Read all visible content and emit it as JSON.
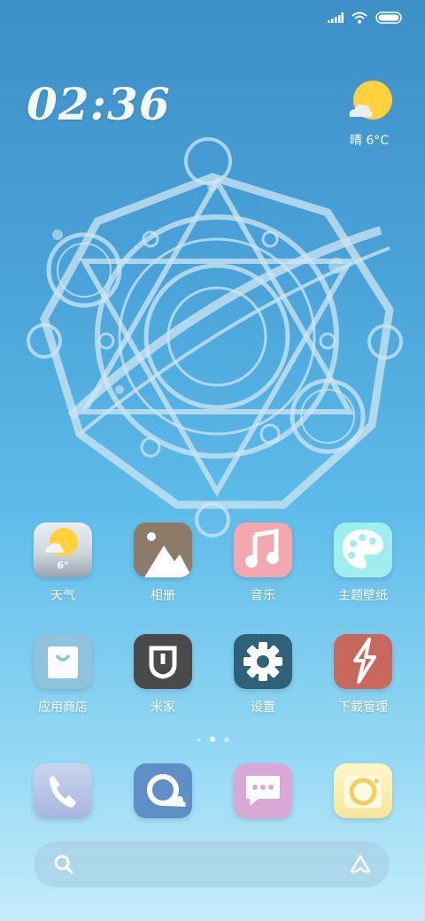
{
  "status_bar": {
    "icons": [
      "signal-icon",
      "wifi-icon",
      "battery-icon"
    ]
  },
  "clock": {
    "time": "02:36"
  },
  "weather": {
    "condition_temp": "晴  6°C",
    "icon": "sun-cloud-icon"
  },
  "apps": [
    {
      "label": "天气",
      "icon": "weather-icon",
      "badge": "6°"
    },
    {
      "label": "相册",
      "icon": "gallery-icon"
    },
    {
      "label": "音乐",
      "icon": "music-icon"
    },
    {
      "label": "主题壁纸",
      "icon": "palette-icon"
    },
    {
      "label": "应用商店",
      "icon": "store-bag-icon"
    },
    {
      "label": "米家",
      "icon": "mijia-icon"
    },
    {
      "label": "设置",
      "icon": "gear-icon"
    },
    {
      "label": "下载管理",
      "icon": "download-bolt-icon"
    }
  ],
  "dock": [
    {
      "icon": "phone-icon"
    },
    {
      "icon": "browser-icon"
    },
    {
      "icon": "messages-icon"
    },
    {
      "icon": "camera-icon"
    }
  ],
  "page_indicator": {
    "pages": 3,
    "active": 2
  },
  "search": {
    "icon": "search-icon",
    "assistant_icon": "assistant-icon"
  },
  "colors": {
    "background_top": "#3d8fc8",
    "background_bottom": "#c6ecfb",
    "sun": "#ffd23c"
  }
}
